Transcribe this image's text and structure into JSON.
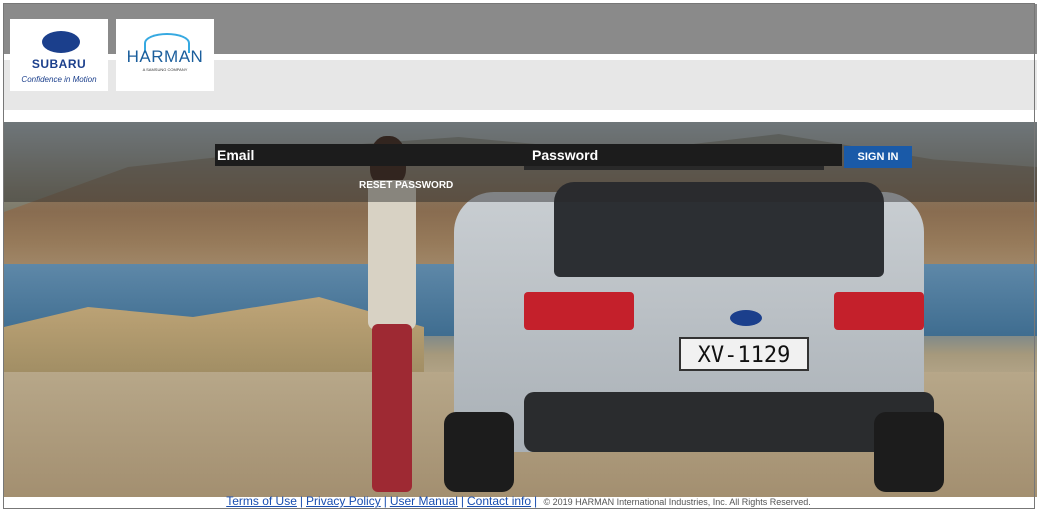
{
  "brand": {
    "subaru_name": "SUBARU",
    "subaru_tagline": "Confidence in Motion",
    "harman_name": "HARMAN",
    "harman_sub": "A SAMSUNG COMPANY"
  },
  "login": {
    "email_placeholder": "Email",
    "password_placeholder": "Password",
    "signin_label": "SIGN IN",
    "reset_label": "RESET PASSWORD"
  },
  "hero": {
    "plate_text": "XV-1129"
  },
  "footer": {
    "links": [
      "Terms of Use",
      "Privacy Policy",
      "User Manual",
      "Contact info"
    ],
    "copyright": "© 2019 HARMAN International Industries, Inc. All Rights Reserved."
  },
  "colors": {
    "signin_bg": "#1a5aa8",
    "link": "#1a4fb0",
    "subaru_blue": "#1b3f8c"
  }
}
